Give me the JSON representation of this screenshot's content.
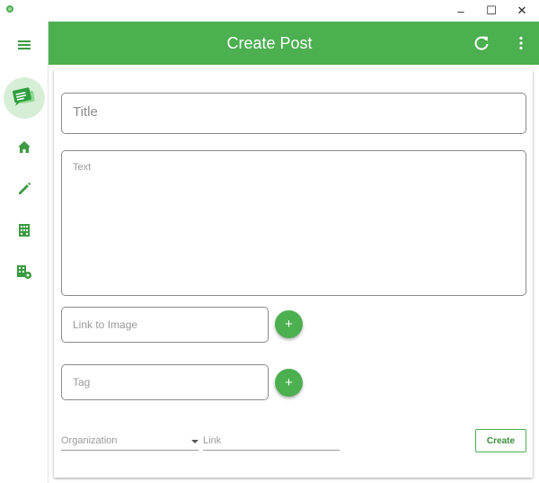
{
  "window": {
    "minimize_glyph": "–",
    "maximize_glyph": "☐",
    "close_glyph": "✕"
  },
  "sidebar": {
    "items": [
      {
        "icon": "menu-icon"
      },
      {
        "icon": "chat-logo-icon"
      },
      {
        "icon": "home-icon"
      },
      {
        "icon": "pencil-icon"
      },
      {
        "icon": "building-icon"
      },
      {
        "icon": "building-settings-icon"
      }
    ]
  },
  "header": {
    "title": "Create Post",
    "actions": [
      {
        "icon": "refresh-icon"
      },
      {
        "icon": "more-vert-icon"
      }
    ]
  },
  "form": {
    "title_placeholder": "Title",
    "text_placeholder": "Text",
    "image_placeholder": "Link to Image",
    "tag_placeholder": "Tag",
    "add_glyph": "+",
    "organization_placeholder": "Organization",
    "link_placeholder": "Link",
    "create_label": "Create"
  },
  "colors": {
    "primary": "#4caf50",
    "on_primary": "#ffffff",
    "icon_green": "#3c9a42"
  }
}
